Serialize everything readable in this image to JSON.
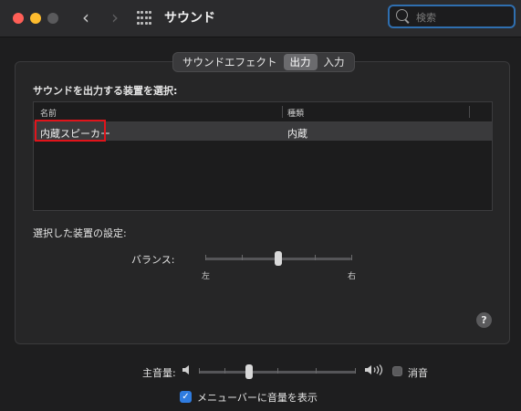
{
  "window": {
    "title": "サウンド"
  },
  "search": {
    "placeholder": "検索",
    "value": ""
  },
  "tabs": [
    {
      "label": "サウンドエフェクト",
      "active": false
    },
    {
      "label": "出力",
      "active": true
    },
    {
      "label": "入力",
      "active": false
    }
  ],
  "output": {
    "heading": "サウンドを出力する装置を選択:",
    "columns": {
      "name": "名前",
      "type": "種類"
    },
    "devices": [
      {
        "name": "内蔵スピーカー",
        "type": "内蔵",
        "selected": true
      }
    ],
    "settings_heading": "選択した装置の設定:",
    "balance": {
      "label": "バランス:",
      "left_label": "左",
      "right_label": "右",
      "value_fraction": 0.5
    }
  },
  "volume": {
    "label": "主音量:",
    "value_fraction": 0.33,
    "mute_label": "消音",
    "muted": false,
    "menubar_label": "メニューバーに音量を表示",
    "menubar_checked": true
  },
  "icons": {
    "back": "chevron-left-icon",
    "forward": "chevron-right-icon",
    "grid": "grid-icon",
    "search": "search-icon",
    "help": "help-icon",
    "speaker_low": "speaker-low-icon",
    "speaker_high": "speaker-high-icon"
  },
  "colors": {
    "highlight_box": "#e0141b",
    "accent": "#2f7ce0",
    "search_border": "#2f6fb0"
  }
}
